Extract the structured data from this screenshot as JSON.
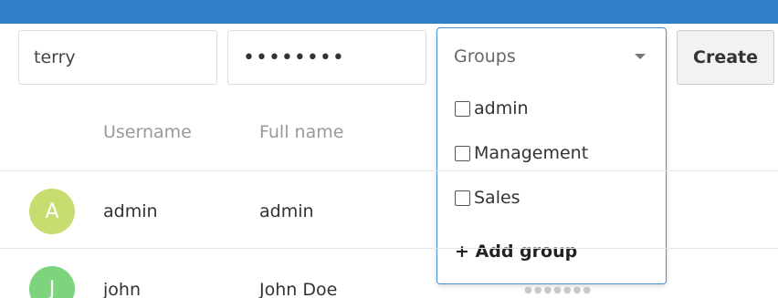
{
  "form": {
    "username_value": "terry",
    "password_value": "••••••••",
    "groups_placeholder": "Groups",
    "create_label": "Create"
  },
  "groups_dropdown": {
    "options": [
      {
        "label": "admin",
        "checked": false
      },
      {
        "label": "Management",
        "checked": false
      },
      {
        "label": "Sales",
        "checked": false
      }
    ],
    "add_group_label": "+ Add group"
  },
  "table": {
    "headers": {
      "username": "Username",
      "full_name": "Full name"
    },
    "rows": [
      {
        "avatar_letter": "A",
        "avatar_color": "#c8dd6f",
        "username": "admin",
        "full_name": "admin"
      },
      {
        "avatar_letter": "J",
        "avatar_color": "#7ed47c",
        "username": "john",
        "full_name": "John Doe",
        "password_mask": "●●●●●●●"
      }
    ]
  },
  "colors": {
    "topbar": "#2f80c7",
    "dropdown_border": "#4a90d9"
  }
}
